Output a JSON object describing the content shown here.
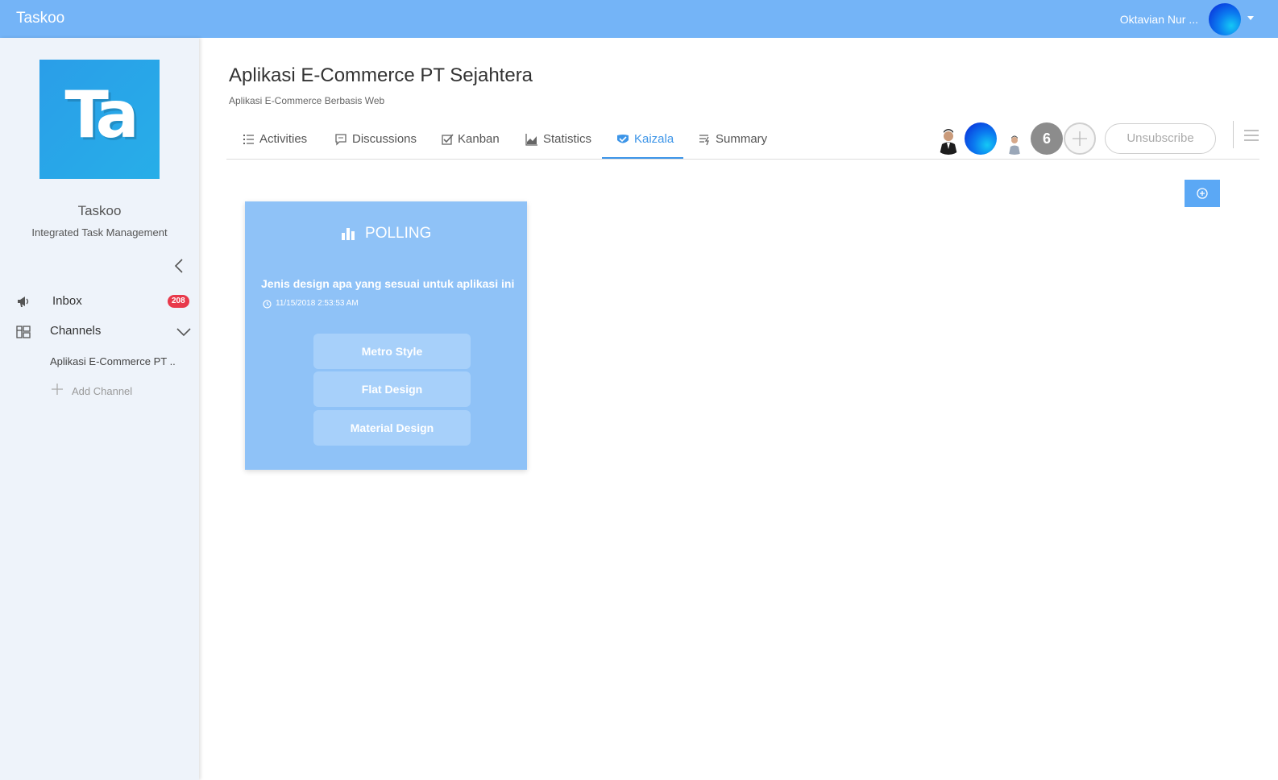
{
  "topbar": {
    "brand": "Taskoo",
    "user_name": "Oktavian Nur ..."
  },
  "sidebar": {
    "logo_text": "Ta",
    "app_name": "Taskoo",
    "app_tagline": "Integrated Task Management",
    "inbox": {
      "label": "Inbox",
      "count": "208"
    },
    "channels": {
      "label": "Channels",
      "items": [
        "Aplikasi E-Commerce PT .."
      ],
      "add_label": "Add Channel"
    }
  },
  "project": {
    "title": "Aplikasi E-Commerce PT Sejahtera",
    "subtitle": "Aplikasi E-Commerce Berbasis Web"
  },
  "tabs": [
    {
      "label": "Activities",
      "icon": "list-icon"
    },
    {
      "label": "Discussions",
      "icon": "chat-icon"
    },
    {
      "label": "Kanban",
      "icon": "checkbox-icon"
    },
    {
      "label": "Statistics",
      "icon": "area-chart-icon"
    },
    {
      "label": "Kaizala",
      "icon": "kaizala-icon",
      "active": true
    },
    {
      "label": "Summary",
      "icon": "summary-icon"
    }
  ],
  "members": {
    "extra_count": "6"
  },
  "actions": {
    "unsubscribe": "Unsubscribe"
  },
  "poll": {
    "heading": "POLLING",
    "question": "Jenis design apa yang sesuai untuk aplikasi ini",
    "timestamp": "11/15/2018 2:53:53 AM",
    "options": [
      "Metro Style",
      "Flat Design",
      "Material Design"
    ]
  },
  "colors": {
    "topbar": "#74b4f7",
    "accent": "#3d95e8",
    "poll_card": "#8fc2f7",
    "badge": "#e8394b"
  }
}
